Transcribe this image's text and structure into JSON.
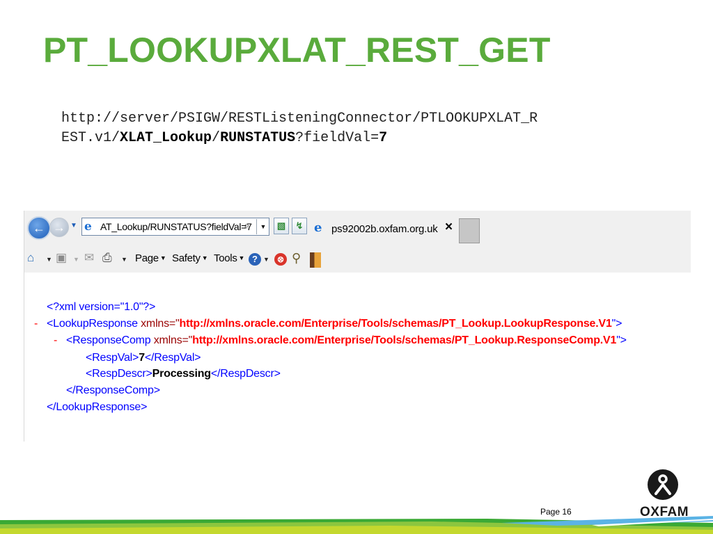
{
  "slide": {
    "title": "PT_LOOKUPXLAT_REST_GET",
    "title_color": "#5aab3c",
    "url_line1": "http://server/PSIGW/RESTListeningConnector/PTLOOKUPXLAT_R",
    "url_line2_prefix": "EST.v1/",
    "url_bold1": "XLAT_Lookup",
    "url_sep": "/",
    "url_bold2": "RUNSTATUS",
    "url_query": "?fieldVal=",
    "url_bold3": "7"
  },
  "browser": {
    "address": "AT_Lookup/RUNSTATUS?fieldVal=7",
    "tab_label": "ps92002b.oxfam.org.uk",
    "tab_close": "×",
    "search_glyph": "⌕",
    "menu": {
      "page": "Page",
      "safety": "Safety",
      "tools": "Tools"
    },
    "help_glyph": "?",
    "stop_glyph": "⊗"
  },
  "xml": {
    "decl": "<?xml version=\"1.0\"?>",
    "minus": "-",
    "lookup_open_tag": "<LookupResponse",
    "lookup_attr": " xmlns=\"",
    "lookup_ns": "http://xmlns.oracle.com/Enterprise/Tools/schemas/PT_Lookup.LookupResponse.V1",
    "lookup_close": "\">",
    "comp_open_tag": "<ResponseComp",
    "comp_attr": " xmlns=\"",
    "comp_ns": "http://xmlns.oracle.com/Enterprise/Tools/schemas/PT_Lookup.ResponseComp.V1",
    "comp_close": "\">",
    "respval_open": "<RespVal>",
    "respval_value": "7",
    "respval_close": "</RespVal>",
    "respdescr_open": "<RespDescr>",
    "respdescr_value": "Processing",
    "respdescr_close": "</RespDescr>",
    "comp_end": "</ResponseComp>",
    "lookup_end": "</LookupResponse>"
  },
  "footer": {
    "page_label": "Page 16",
    "logo_text": "OXFAM",
    "stripe_colors": [
      "#3aa935",
      "#8cc63f",
      "#c4d82e",
      "#5bb3e5"
    ]
  }
}
